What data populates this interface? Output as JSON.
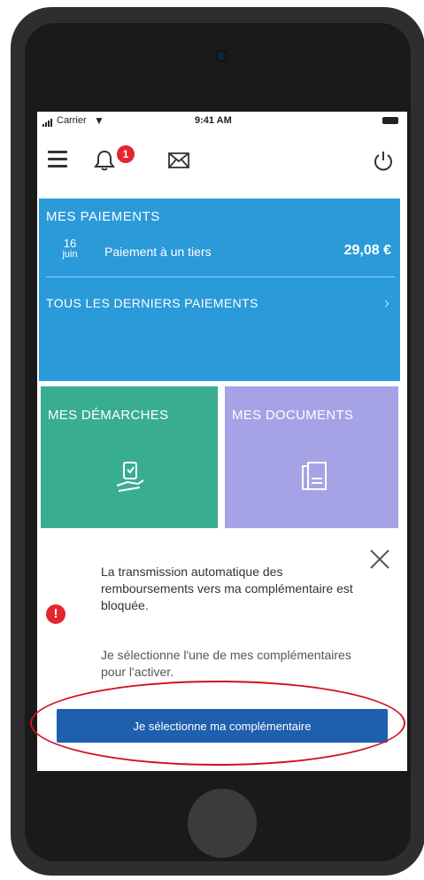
{
  "status_bar": {
    "carrier": "Carrier",
    "time": "9:41 AM"
  },
  "header": {
    "notification_count": "1"
  },
  "payments": {
    "title": "MES PAIEMENTS",
    "latest": {
      "day": "16",
      "month": "juin",
      "label": "Paiement à un tiers",
      "amount": "29,08 €"
    },
    "all_link": "TOUS LES DERNIERS PAIEMENTS"
  },
  "tiles": {
    "demarches": "MES DÉMARCHES",
    "documents": "MES DOCUMENTS"
  },
  "alert": {
    "message": "La transmission automatique des remboursements vers ma complémentaire est bloquée.",
    "instruction": "Je sélectionne l'une de mes complémentaires pour l'activer.",
    "button_label": "Je sélectionne ma complémentaire"
  },
  "colors": {
    "payments_tile": "#2b9ad9",
    "demarches_tile": "#39ad90",
    "documents_tile": "#a5a2e6",
    "primary_button": "#1e5fae",
    "badge": "#e3262f",
    "highlight": "#d1121f"
  }
}
